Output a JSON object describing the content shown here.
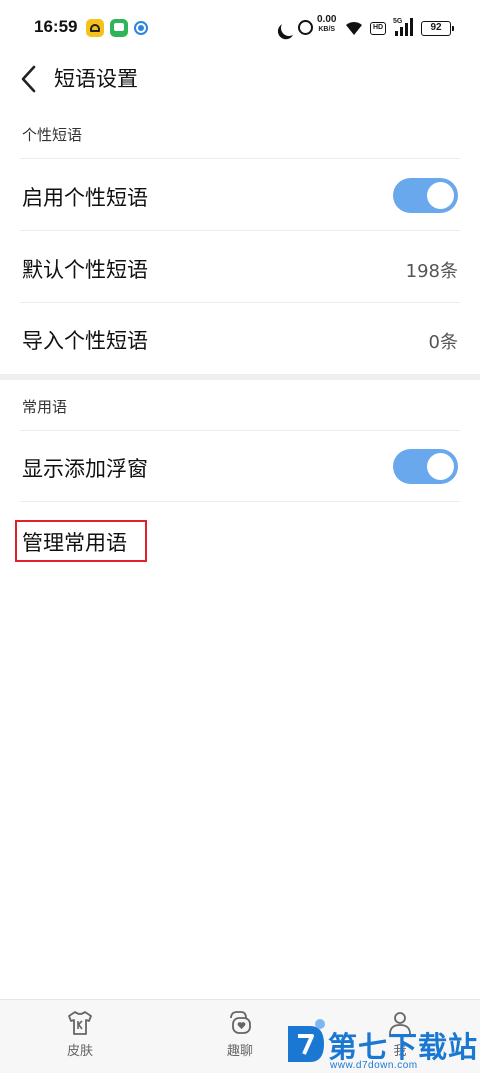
{
  "status_bar": {
    "time": "16:59",
    "speed_value": "0.00",
    "speed_unit": "KB/S",
    "hd": "HD",
    "network": "5G",
    "battery": "92"
  },
  "header": {
    "title": "短语设置"
  },
  "personal_section": {
    "heading": "个性短语",
    "enable_label": "启用个性短语",
    "enable_on": true,
    "default_label": "默认个性短语",
    "default_value": "198条",
    "import_label": "导入个性短语",
    "import_value": "0条"
  },
  "common_section": {
    "heading": "常用语",
    "float_label": "显示添加浮窗",
    "float_on": true,
    "manage_label": "管理常用语"
  },
  "bottom_nav": {
    "skin": "皮肤",
    "chat": "趣聊",
    "me": "我"
  },
  "watermark": {
    "text": "第七下载站",
    "url": "www.d7down.com"
  },
  "colors": {
    "toggle_on": "#6aa8ee",
    "highlight": "#e0202a",
    "watermark": "#1a77d2"
  }
}
